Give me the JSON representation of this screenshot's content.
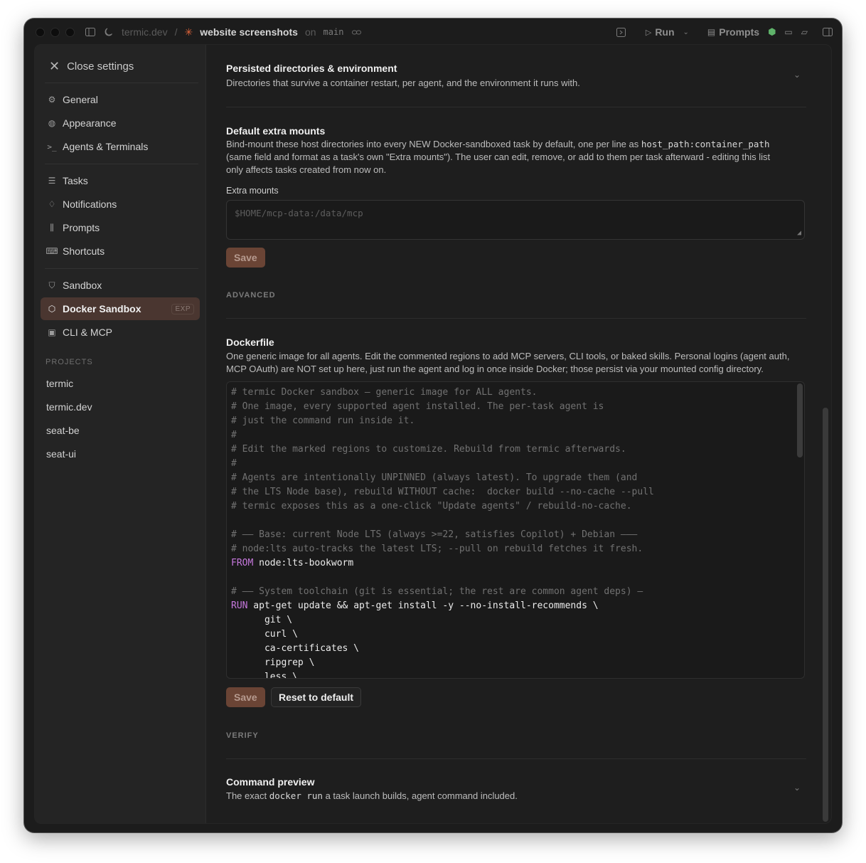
{
  "titlebar": {
    "project": "termic.dev",
    "separator": "/",
    "task": "website screenshots",
    "on_label": "on",
    "branch": "main",
    "run_label": "Run",
    "prompts_label": "Prompts"
  },
  "sidebar": {
    "close_label": "Close settings",
    "groups": [
      [
        {
          "label": "General",
          "icon": "gear-icon"
        },
        {
          "label": "Appearance",
          "icon": "palette-icon"
        },
        {
          "label": "Agents & Terminals",
          "icon": "terminal-icon"
        }
      ],
      [
        {
          "label": "Tasks",
          "icon": "list-icon"
        },
        {
          "label": "Notifications",
          "icon": "bell-icon"
        },
        {
          "label": "Prompts",
          "icon": "library-icon"
        },
        {
          "label": "Shortcuts",
          "icon": "keyboard-icon"
        }
      ],
      [
        {
          "label": "Sandbox",
          "icon": "shield-icon"
        },
        {
          "label": "Docker Sandbox",
          "icon": "cube-icon",
          "badge": "EXP",
          "active": true
        },
        {
          "label": "CLI & MCP",
          "icon": "terminal-box-icon"
        }
      ]
    ],
    "projects_heading": "PROJECTS",
    "projects": [
      "termic",
      "termic.dev",
      "seat-be",
      "seat-ui"
    ]
  },
  "content": {
    "persisted": {
      "title": "Persisted directories & environment",
      "desc": "Directories that survive a container restart, per agent, and the environment it runs with."
    },
    "mounts": {
      "title": "Default extra mounts",
      "desc_1": "Bind-mount these host directories into every NEW Docker-sandboxed task by default, one per line as ",
      "desc_code": "host_path:container_path",
      "desc_2": "(same field and format as a task's own \"Extra mounts\"). The user can edit, remove, or add to them per task afterward - editing this list",
      "desc_3": "only affects tasks created from now on.",
      "field_label": "Extra mounts",
      "placeholder": "$HOME/mcp-data:/data/mcp",
      "save_label": "Save"
    },
    "advanced_heading": "ADVANCED",
    "dockerfile": {
      "title": "Dockerfile",
      "desc_1": "One generic image for all agents. Edit the commented regions to add MCP servers, CLI tools, or baked skills. Personal logins (agent auth,",
      "desc_2": "MCP OAuth) are NOT set up here, just run the agent and log in once inside Docker; those persist via your mounted config directory.",
      "lines": [
        {
          "t": "comment",
          "s": "# termic Docker sandbox — generic image for ALL agents."
        },
        {
          "t": "comment",
          "s": "# One image, every supported agent installed. The per-task agent is"
        },
        {
          "t": "comment",
          "s": "# just the command run inside it."
        },
        {
          "t": "comment",
          "s": "#"
        },
        {
          "t": "comment",
          "s": "# Edit the marked regions to customize. Rebuild from termic afterwards."
        },
        {
          "t": "comment",
          "s": "#"
        },
        {
          "t": "comment",
          "s": "# Agents are intentionally UNPINNED (always latest). To upgrade them (and"
        },
        {
          "t": "comment",
          "s": "# the LTS Node base), rebuild WITHOUT cache:  docker build --no-cache --pull"
        },
        {
          "t": "comment",
          "s": "# termic exposes this as a one-click \"Update agents\" / rebuild-no-cache."
        },
        {
          "t": "blank",
          "s": ""
        },
        {
          "t": "comment",
          "s": "# —— Base: current Node LTS (always >=22, satisfies Copilot) + Debian ———"
        },
        {
          "t": "comment",
          "s": "# node:lts auto-tracks the latest LTS; --pull on rebuild fetches it fresh."
        },
        {
          "t": "kw",
          "k": "FROM",
          "s": " node:lts-bookworm"
        },
        {
          "t": "blank",
          "s": ""
        },
        {
          "t": "comment",
          "s": "# —— System toolchain (git is essential; the rest are common agent deps) —"
        },
        {
          "t": "kw",
          "k": "RUN",
          "s": " apt-get update && apt-get install -y --no-install-recommends \\"
        },
        {
          "t": "text",
          "s": "      git \\"
        },
        {
          "t": "text",
          "s": "      curl \\"
        },
        {
          "t": "text",
          "s": "      ca-certificates \\"
        },
        {
          "t": "text",
          "s": "      ripgrep \\"
        },
        {
          "t": "text",
          "s": "      less \\"
        }
      ],
      "save_label": "Save",
      "reset_label": "Reset to default"
    },
    "verify_heading": "VERIFY",
    "preview": {
      "title": "Command preview",
      "desc_1": "The exact ",
      "desc_code": "docker run",
      "desc_2": " a task launch builds, agent command included."
    }
  }
}
